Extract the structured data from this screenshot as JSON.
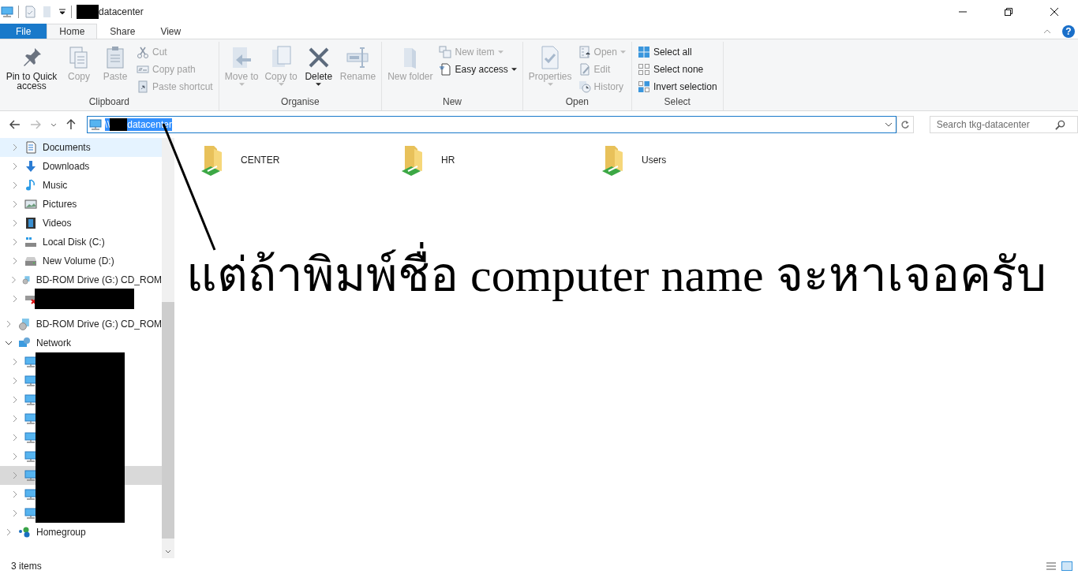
{
  "window": {
    "title_segments": [
      {
        "kind": "redacted"
      },
      {
        "kind": "text",
        "text": "datacenter"
      }
    ]
  },
  "ribbon_tabs": [
    {
      "label": "File",
      "kind": "file",
      "selected": false
    },
    {
      "label": "Home",
      "kind": "tab",
      "selected": true
    },
    {
      "label": "Share",
      "kind": "tab",
      "selected": false
    },
    {
      "label": "View",
      "kind": "tab",
      "selected": false
    }
  ],
  "ribbon_groups": [
    {
      "label": "Clipboard",
      "columns": [
        [
          {
            "label": "Pin to Quick access",
            "kind": "large",
            "disabled": false
          }
        ],
        [
          {
            "label": "Copy",
            "kind": "large",
            "disabled": true
          }
        ],
        [
          {
            "label": "Paste",
            "kind": "large",
            "disabled": true
          }
        ],
        [
          {
            "label": "Cut",
            "kind": "small",
            "disabled": true
          },
          {
            "label": "Copy path",
            "kind": "small",
            "disabled": true
          },
          {
            "label": "Paste shortcut",
            "kind": "small",
            "disabled": true
          }
        ]
      ]
    },
    {
      "label": "Organise",
      "columns": [
        [
          {
            "label": "Move to",
            "kind": "large",
            "disabled": true,
            "dropdown": true
          }
        ],
        [
          {
            "label": "Copy to",
            "kind": "large",
            "disabled": true,
            "dropdown": true
          }
        ],
        [
          {
            "label": "Delete",
            "kind": "large",
            "disabled": false,
            "dropdown": true
          }
        ],
        [
          {
            "label": "Rename",
            "kind": "large",
            "disabled": true
          }
        ]
      ]
    },
    {
      "label": "New",
      "columns": [
        [
          {
            "label": "New folder",
            "kind": "large",
            "disabled": true
          }
        ],
        [
          {
            "label": "New item",
            "kind": "small",
            "disabled": true,
            "dropdown": true
          },
          {
            "label": "Easy access",
            "kind": "small",
            "disabled": false,
            "dropdown": true
          }
        ]
      ]
    },
    {
      "label": "Open",
      "columns": [
        [
          {
            "label": "Properties",
            "kind": "large",
            "disabled": true,
            "dropdown": true
          }
        ],
        [
          {
            "label": "Open",
            "kind": "small",
            "disabled": true,
            "dropdown": true
          },
          {
            "label": "Edit",
            "kind": "small",
            "disabled": true
          },
          {
            "label": "History",
            "kind": "small",
            "disabled": true
          }
        ]
      ]
    },
    {
      "label": "Select",
      "columns": [
        [
          {
            "label": "Select all",
            "kind": "small",
            "disabled": false
          },
          {
            "label": "Select none",
            "kind": "small",
            "disabled": false
          },
          {
            "label": "Invert selection",
            "kind": "small",
            "disabled": false
          }
        ]
      ]
    }
  ],
  "address": {
    "selected": true,
    "segments": [
      {
        "kind": "text",
        "text": "\\\\"
      },
      {
        "kind": "redacted"
      },
      {
        "kind": "text",
        "text": "datacenter"
      }
    ]
  },
  "search": {
    "placeholder": "Search tkg-datacenter"
  },
  "help_button": {
    "text": "?"
  },
  "sidebar": {
    "scrolled_children": [
      {
        "kind": "item",
        "label": "Documents",
        "hovered": true,
        "selected": false
      },
      {
        "kind": "item",
        "label": "Downloads",
        "hovered": false,
        "selected": false
      },
      {
        "kind": "item",
        "label": "Music",
        "hovered": false,
        "selected": false
      },
      {
        "kind": "item",
        "label": "Pictures",
        "hovered": false,
        "selected": false
      },
      {
        "kind": "item",
        "label": "Videos",
        "hovered": false,
        "selected": false
      },
      {
        "kind": "item",
        "label": "Local Disk (C:)",
        "hovered": false,
        "selected": false
      },
      {
        "kind": "item",
        "label": "New Volume (D:)",
        "hovered": false,
        "selected": false
      },
      {
        "kind": "item",
        "label": "BD-ROM Drive (G:) CD_ROM",
        "hovered": false,
        "selected": false
      },
      {
        "kind": "redacted",
        "hovered": false,
        "selected": false
      }
    ],
    "items": [
      {
        "kind": "item",
        "label": "BD-ROM Drive (G:) CD_ROM",
        "expanded": false,
        "hovered": false,
        "selected": false
      },
      {
        "kind": "item",
        "label": "Network",
        "expanded": true,
        "hovered": false,
        "selected": false,
        "children": [
          {
            "kind": "redacted",
            "selected": false
          },
          {
            "kind": "redacted",
            "selected": false
          },
          {
            "kind": "redacted",
            "selected": false
          },
          {
            "kind": "redacted",
            "selected": false
          },
          {
            "kind": "redacted",
            "selected": false
          },
          {
            "kind": "redacted",
            "selected": false
          },
          {
            "kind": "redacted",
            "selected": true
          },
          {
            "kind": "redacted",
            "selected": false
          },
          {
            "kind": "redacted",
            "selected": false
          }
        ]
      },
      {
        "kind": "item",
        "label": "Homegroup",
        "expanded": false,
        "hovered": false,
        "selected": false
      }
    ]
  },
  "folders": [
    {
      "label": "CENTER"
    },
    {
      "label": "HR"
    },
    {
      "label": "Users"
    }
  ],
  "annotation": {
    "text": "แต่ถ้าพิมพ์ชื่อ computer name จะหาเจอครับ"
  },
  "status_bar": {
    "text": "3 items"
  }
}
